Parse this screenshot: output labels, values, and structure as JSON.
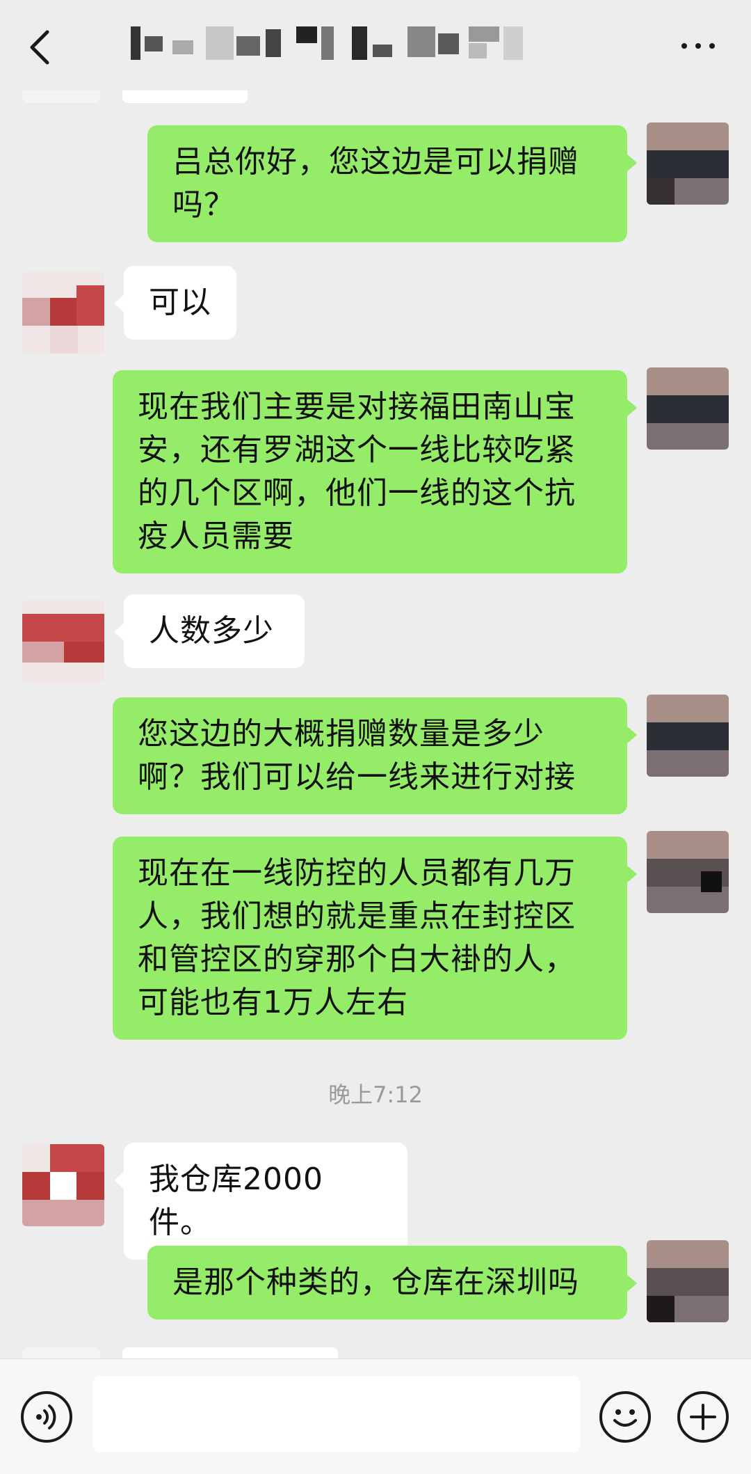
{
  "header": {
    "back_icon": "chevron-left-icon",
    "title_obscured": true,
    "more_icon": "more-dots-icon"
  },
  "messages": [
    {
      "sender": "me",
      "text": "吕总你好，您这边是可以捐赠吗？"
    },
    {
      "sender": "them",
      "text": "可以"
    },
    {
      "sender": "me",
      "text": "现在我们主要是对接福田南山宝安，还有罗湖这个一线比较吃紧的几个区啊，他们一线的这个抗疫人员需要"
    },
    {
      "sender": "them",
      "text": "人数多少"
    },
    {
      "sender": "me",
      "text": "您这边的大概捐赠数量是多少啊？我们可以给一线来进行对接"
    },
    {
      "sender": "me",
      "text": "现在在一线防控的人员都有几万人，我们想的就是重点在封控区和管控区的穿那个白大褂的人，可能也有1万人左右"
    },
    {
      "sender": "them",
      "text": "我仓库2000件。"
    },
    {
      "sender": "me",
      "text": "是那个种类的，仓库在深圳吗"
    }
  ],
  "timestamp": "晚上7:12",
  "input_bar": {
    "voice_icon": "voice-icon",
    "input_value": "",
    "emoji_icon": "emoji-icon",
    "plus_icon": "plus-icon"
  },
  "colors": {
    "background": "#ededed",
    "my_bubble": "#95ec69",
    "their_bubble": "#ffffff",
    "timestamp_text": "#9a9a9a"
  }
}
